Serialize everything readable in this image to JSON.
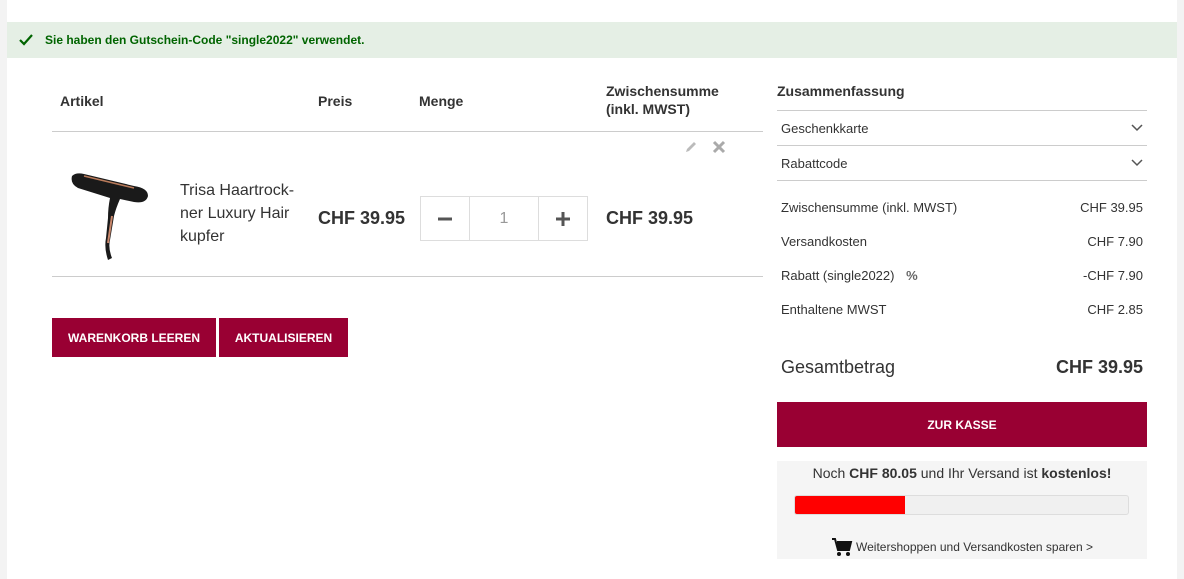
{
  "notice": {
    "message": "Sie haben den Gutschein-Code \"single2022\" verwendet.",
    "icon": "checkmark-icon"
  },
  "cart": {
    "headers": {
      "article": "Artikel",
      "price": "Preis",
      "quantity": "Menge",
      "subtotal_line1": "Zwischensumme",
      "subtotal_line2": "(inkl. MWST)"
    },
    "item": {
      "name": "Trisa Haartrock-ner Luxury Hair kupfer",
      "price": "CHF 39.95",
      "qty": "1",
      "subtotal": "CHF 39.95",
      "minus": "−",
      "plus": "+"
    },
    "buttons": {
      "clear": "WARENKORB LEEREN",
      "update": "AKTUALISIEREN"
    }
  },
  "summary": {
    "title": "Zusammenfassung",
    "accordions": [
      "Geschenkkarte",
      "Rabattcode"
    ],
    "lines": [
      {
        "label": "Zwischensumme (inkl. MWST)",
        "value": "CHF 39.95"
      },
      {
        "label": "Versandkosten",
        "value": "CHF 7.90"
      },
      {
        "label": "Rabatt (single2022)",
        "value": "-CHF 7.90",
        "icon": "%"
      },
      {
        "label": "Enthaltene MWST",
        "value": "CHF 2.85"
      }
    ],
    "total_label": "Gesamtbetrag",
    "total_value": "CHF 39.95",
    "checkout": "ZUR KASSE",
    "shipping": {
      "prefix": "Noch ",
      "amount": "CHF 80.05",
      "middle": " und Ihr Versand ist ",
      "free": "kostenlos!",
      "progress": 0.33,
      "link": "Weitershoppen und Versandkosten sparen >"
    }
  },
  "colors": {
    "accent": "#990033",
    "success": "#006400",
    "progress": "#ff0000"
  }
}
